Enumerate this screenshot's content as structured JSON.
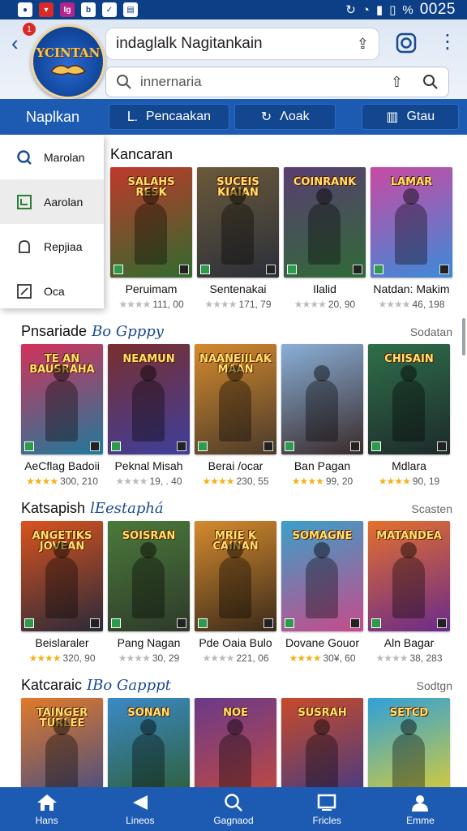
{
  "status_bar": {
    "time": "0025",
    "right_extra": "%",
    "left_icons": [
      "app-icon-1",
      "app-icon-2",
      "app-icon-3",
      "app-icon-4",
      "app-icon-5",
      "app-icon-6"
    ]
  },
  "header": {
    "logo_text": "YCINTAN",
    "badge": "1",
    "url": "indaglalk Nagitankain",
    "search_placeholder": "innernaria"
  },
  "tabs": {
    "home": "Naplkan",
    "items": [
      "Pencaakan",
      "Λoak",
      "Gtau"
    ]
  },
  "dropdown": {
    "items": [
      "Marolan",
      "Aarolan",
      "Repjiaa",
      "Oca"
    ]
  },
  "sections": [
    {
      "title": "Kancaran",
      "subtitle": "",
      "link": "",
      "cards": [
        {
          "poster": "SALAHS RESK",
          "name": "Peruimam",
          "stars": "★★★★",
          "rating": "111, 00",
          "gold": false,
          "color1": "#c0392b",
          "color2": "#2f6b2e"
        },
        {
          "poster": "SUCEIS KIAIAN",
          "name": "Sentenakai",
          "stars": "★★★★",
          "rating": "171, 79",
          "gold": false,
          "color1": "#6b5a3a",
          "color2": "#2b2f3a"
        },
        {
          "poster": "COINRANK",
          "name": "Ilalid",
          "stars": "★★★★",
          "rating": "20, 90",
          "gold": false,
          "color1": "#5a3d72",
          "color2": "#2f6b36"
        },
        {
          "poster": "LAMAR",
          "name": "Natdan: Makim",
          "stars": "★★★★",
          "rating": "46, 198",
          "gold": false,
          "color1": "#c94aa3",
          "color2": "#3c8ad8"
        }
      ]
    },
    {
      "title": "Pnsariade",
      "subtitle": "Bo Gpppy",
      "link": "Sodatan",
      "cards": [
        {
          "poster": "TE AN BAUSRAHA",
          "name": "AeCflag Badoii",
          "stars": "★★★★",
          "rating": "300, 210",
          "gold": true,
          "color1": "#d2325a",
          "color2": "#1f7a9b"
        },
        {
          "poster": "NEAMUN",
          "name": "Peknal Misah",
          "stars": "★★★★",
          "rating": "19, . 40",
          "gold": false,
          "color1": "#7a2e2e",
          "color2": "#3d3f9c"
        },
        {
          "poster": "NAANEIILAK MAAN",
          "name": "Berai /ocar",
          "stars": "★★★★",
          "rating": "230, 55",
          "gold": true,
          "color1": "#d48a2e",
          "color2": "#4a3a2a"
        },
        {
          "poster": "",
          "name": "Ban Pagan",
          "stars": "★★★★",
          "rating": "99, 20",
          "gold": true,
          "color1": "#8ab0d8",
          "color2": "#3a2a2a"
        },
        {
          "poster": "CHISAIN",
          "name": "Mdlara",
          "stars": "★★★★",
          "rating": "90, 19",
          "gold": true,
          "color1": "#2e6f4a",
          "color2": "#1d2a2a"
        }
      ]
    },
    {
      "title": "Katsapish",
      "subtitle": "lEestaphá",
      "link": "Scasten",
      "cards": [
        {
          "poster": "ANGETIKS JOVEAN",
          "name": "Beislaraler",
          "stars": "★★★★",
          "rating": "320, 90",
          "gold": true,
          "color1": "#d9531e",
          "color2": "#2a2a3a"
        },
        {
          "poster": "SOISRAN",
          "name": "Pang Nagan",
          "stars": "★★★★",
          "rating": "30, 29",
          "gold": false,
          "color1": "#4a7a3a",
          "color2": "#2e3a2a"
        },
        {
          "poster": "MRIE K CAINAN",
          "name": "Pde Oaia Bulo",
          "stars": "★★★★",
          "rating": "221, 06",
          "gold": false,
          "color1": "#d48a2e",
          "color2": "#3a2a1a"
        },
        {
          "poster": "SOMAGNE",
          "name": "Dovane Gouor",
          "stars": "★★★★",
          "rating": "30¥, 60",
          "gold": true,
          "color1": "#3aa0c8",
          "color2": "#c84a8a"
        },
        {
          "poster": "MATANDEA",
          "name": "Aln Bagar",
          "stars": "★★★★",
          "rating": "38, 283",
          "gold": false,
          "color1": "#e3702e",
          "color2": "#6a2a8a"
        }
      ]
    },
    {
      "title": "Katcaraic",
      "subtitle": "IBo Gapppt",
      "link": "Sodtgn",
      "cards": [
        {
          "poster": "TAINGER TURLEE",
          "name": "",
          "stars": "",
          "rating": "",
          "gold": false,
          "color1": "#e07a2a",
          "color2": "#3a4a8a"
        },
        {
          "poster": "SONAN",
          "name": "",
          "stars": "",
          "rating": "",
          "gold": false,
          "color1": "#3a8ac8",
          "color2": "#2e5a2a"
        },
        {
          "poster": "NOE",
          "name": "",
          "stars": "",
          "rating": "",
          "gold": false,
          "color1": "#6a3a8a",
          "color2": "#c84a3a"
        },
        {
          "poster": "SUSRAH",
          "name": "",
          "stars": "",
          "rating": "",
          "gold": false,
          "color1": "#c84a2a",
          "color2": "#3a3a8a"
        },
        {
          "poster": "SETCD",
          "name": "",
          "stars": "",
          "rating": "",
          "gold": false,
          "color1": "#2ea0d8",
          "color2": "#e8d02a"
        }
      ]
    }
  ],
  "bottom_nav": {
    "items": [
      {
        "label": "Hans",
        "icon": "home-icon"
      },
      {
        "label": "Lineos",
        "icon": "back-triangle-icon"
      },
      {
        "label": "Gagnaod",
        "icon": "search-icon"
      },
      {
        "label": "Fricles",
        "icon": "square-icon"
      },
      {
        "label": "Emme",
        "icon": "user-icon"
      }
    ]
  }
}
